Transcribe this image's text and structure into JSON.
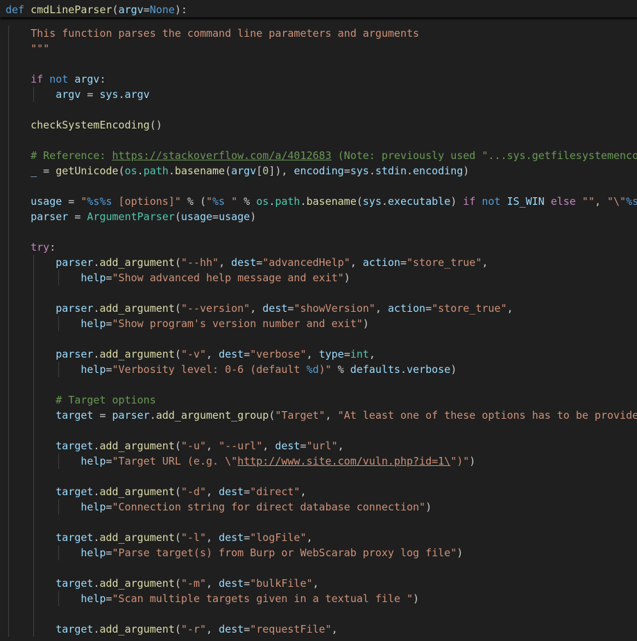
{
  "theme": {
    "background": "#1f1f1f",
    "default": "#cccccc",
    "keyword": "#569cd6",
    "control": "#c586c0",
    "function": "#dcdcaa",
    "variable": "#9cdcfe",
    "string": "#ce9178",
    "comment": "#6a9955",
    "class": "#4ec9b0",
    "number": "#b5cea8",
    "indent_guide": "#404040"
  },
  "sticky_scroll": {
    "line": [
      [
        "k",
        "def"
      ],
      [
        "d",
        " "
      ],
      [
        "f",
        "cmdLineParser"
      ],
      [
        "d",
        "("
      ],
      [
        "p",
        "argv"
      ],
      [
        "d",
        "="
      ],
      [
        "k",
        "None"
      ],
      [
        "d",
        "):"
      ]
    ]
  },
  "code_lines": [
    {
      "indent": 1,
      "tokens": [
        [
          "s",
          "This function parses the command line parameters and arguments"
        ]
      ]
    },
    {
      "indent": 1,
      "tokens": [
        [
          "s",
          "\"\"\""
        ]
      ]
    },
    {
      "indent": 1,
      "tokens": []
    },
    {
      "indent": 1,
      "tokens": [
        [
          "kc",
          "if"
        ],
        [
          "d",
          " "
        ],
        [
          "k",
          "not"
        ],
        [
          "d",
          " "
        ],
        [
          "p",
          "argv"
        ],
        [
          "d",
          ":"
        ]
      ]
    },
    {
      "indent": 2,
      "tokens": [
        [
          "p",
          "argv"
        ],
        [
          "d",
          " = "
        ],
        [
          "p",
          "sys"
        ],
        [
          "d",
          "."
        ],
        [
          "p",
          "argv"
        ]
      ]
    },
    {
      "indent": 1,
      "tokens": []
    },
    {
      "indent": 1,
      "tokens": [
        [
          "f",
          "checkSystemEncoding"
        ],
        [
          "d",
          "()"
        ]
      ]
    },
    {
      "indent": 1,
      "tokens": []
    },
    {
      "indent": 1,
      "tokens": [
        [
          "c",
          "# Reference: "
        ],
        [
          "cu",
          "https://stackoverflow.com/a/4012683"
        ],
        [
          "c",
          " (Note: previously used \"...sys.getfilesystemencoding() or"
        ]
      ]
    },
    {
      "indent": 1,
      "tokens": [
        [
          "p",
          "_"
        ],
        [
          "d",
          " = "
        ],
        [
          "f",
          "getUnicode"
        ],
        [
          "d",
          "("
        ],
        [
          "cl",
          "os"
        ],
        [
          "d",
          "."
        ],
        [
          "cl",
          "path"
        ],
        [
          "d",
          "."
        ],
        [
          "f",
          "basename"
        ],
        [
          "d",
          "("
        ],
        [
          "p",
          "argv"
        ],
        [
          "d",
          "["
        ],
        [
          "n",
          "0"
        ],
        [
          "d",
          "]), "
        ],
        [
          "p",
          "encoding"
        ],
        [
          "d",
          "="
        ],
        [
          "p",
          "sys"
        ],
        [
          "d",
          "."
        ],
        [
          "p",
          "stdin"
        ],
        [
          "d",
          "."
        ],
        [
          "p",
          "encoding"
        ],
        [
          "d",
          ")"
        ]
      ]
    },
    {
      "indent": 1,
      "tokens": []
    },
    {
      "indent": 1,
      "tokens": [
        [
          "p",
          "usage"
        ],
        [
          "d",
          " = "
        ],
        [
          "s",
          "\""
        ],
        [
          "k",
          "%s%s"
        ],
        [
          "s",
          " [options]\""
        ],
        [
          "d",
          " % ("
        ],
        [
          "s",
          "\""
        ],
        [
          "k",
          "%s"
        ],
        [
          "s",
          " \""
        ],
        [
          "d",
          " % "
        ],
        [
          "cl",
          "os"
        ],
        [
          "d",
          "."
        ],
        [
          "cl",
          "path"
        ],
        [
          "d",
          "."
        ],
        [
          "f",
          "basename"
        ],
        [
          "d",
          "("
        ],
        [
          "p",
          "sys"
        ],
        [
          "d",
          "."
        ],
        [
          "p",
          "executable"
        ],
        [
          "d",
          ") "
        ],
        [
          "kc",
          "if"
        ],
        [
          "d",
          " "
        ],
        [
          "k",
          "not"
        ],
        [
          "d",
          " "
        ],
        [
          "p",
          "IS_WIN"
        ],
        [
          "d",
          " "
        ],
        [
          "kc",
          "else"
        ],
        [
          "d",
          " "
        ],
        [
          "s",
          "\"\""
        ],
        [
          "d",
          ", "
        ],
        [
          "s",
          "\"\\\""
        ],
        [
          "k",
          "%s"
        ],
        [
          "s",
          "\\\"\""
        ]
      ]
    },
    {
      "indent": 1,
      "tokens": [
        [
          "p",
          "parser"
        ],
        [
          "d",
          " = "
        ],
        [
          "cl",
          "ArgumentParser"
        ],
        [
          "d",
          "("
        ],
        [
          "p",
          "usage"
        ],
        [
          "d",
          "="
        ],
        [
          "p",
          "usage"
        ],
        [
          "d",
          ")"
        ]
      ]
    },
    {
      "indent": 1,
      "tokens": []
    },
    {
      "indent": 1,
      "tokens": [
        [
          "kc",
          "try"
        ],
        [
          "d",
          ":"
        ]
      ]
    },
    {
      "indent": 2,
      "tokens": [
        [
          "p",
          "parser"
        ],
        [
          "d",
          "."
        ],
        [
          "f",
          "add_argument"
        ],
        [
          "d",
          "("
        ],
        [
          "s",
          "\"--hh\""
        ],
        [
          "d",
          ", "
        ],
        [
          "p",
          "dest"
        ],
        [
          "d",
          "="
        ],
        [
          "s",
          "\"advancedHelp\""
        ],
        [
          "d",
          ", "
        ],
        [
          "p",
          "action"
        ],
        [
          "d",
          "="
        ],
        [
          "s",
          "\"store_true\""
        ],
        [
          "d",
          ","
        ]
      ]
    },
    {
      "indent": 3,
      "tokens": [
        [
          "p",
          "help"
        ],
        [
          "d",
          "="
        ],
        [
          "s",
          "\"Show advanced help message and exit\""
        ],
        [
          "d",
          ")"
        ]
      ]
    },
    {
      "indent": 2,
      "tokens": []
    },
    {
      "indent": 2,
      "tokens": [
        [
          "p",
          "parser"
        ],
        [
          "d",
          "."
        ],
        [
          "f",
          "add_argument"
        ],
        [
          "d",
          "("
        ],
        [
          "s",
          "\"--version\""
        ],
        [
          "d",
          ", "
        ],
        [
          "p",
          "dest"
        ],
        [
          "d",
          "="
        ],
        [
          "s",
          "\"showVersion\""
        ],
        [
          "d",
          ", "
        ],
        [
          "p",
          "action"
        ],
        [
          "d",
          "="
        ],
        [
          "s",
          "\"store_true\""
        ],
        [
          "d",
          ","
        ]
      ]
    },
    {
      "indent": 3,
      "tokens": [
        [
          "p",
          "help"
        ],
        [
          "d",
          "="
        ],
        [
          "s",
          "\"Show program's version number and exit\""
        ],
        [
          "d",
          ")"
        ]
      ]
    },
    {
      "indent": 2,
      "tokens": []
    },
    {
      "indent": 2,
      "tokens": [
        [
          "p",
          "parser"
        ],
        [
          "d",
          "."
        ],
        [
          "f",
          "add_argument"
        ],
        [
          "d",
          "("
        ],
        [
          "s",
          "\"-v\""
        ],
        [
          "d",
          ", "
        ],
        [
          "p",
          "dest"
        ],
        [
          "d",
          "="
        ],
        [
          "s",
          "\"verbose\""
        ],
        [
          "d",
          ", "
        ],
        [
          "p",
          "type"
        ],
        [
          "d",
          "="
        ],
        [
          "cl",
          "int"
        ],
        [
          "d",
          ","
        ]
      ]
    },
    {
      "indent": 3,
      "tokens": [
        [
          "p",
          "help"
        ],
        [
          "d",
          "="
        ],
        [
          "s",
          "\"Verbosity level: 0-6 (default "
        ],
        [
          "k",
          "%d"
        ],
        [
          "s",
          ")\""
        ],
        [
          "d",
          " % "
        ],
        [
          "p",
          "defaults"
        ],
        [
          "d",
          "."
        ],
        [
          "p",
          "verbose"
        ],
        [
          "d",
          ")"
        ]
      ]
    },
    {
      "indent": 2,
      "tokens": []
    },
    {
      "indent": 2,
      "tokens": [
        [
          "c",
          "# Target options"
        ]
      ]
    },
    {
      "indent": 2,
      "tokens": [
        [
          "p",
          "target"
        ],
        [
          "d",
          " = "
        ],
        [
          "p",
          "parser"
        ],
        [
          "d",
          "."
        ],
        [
          "f",
          "add_argument_group"
        ],
        [
          "d",
          "("
        ],
        [
          "s",
          "\"Target\""
        ],
        [
          "d",
          ", "
        ],
        [
          "s",
          "\"At least one of these options has to be provided to"
        ]
      ]
    },
    {
      "indent": 2,
      "tokens": []
    },
    {
      "indent": 2,
      "tokens": [
        [
          "p",
          "target"
        ],
        [
          "d",
          "."
        ],
        [
          "f",
          "add_argument"
        ],
        [
          "d",
          "("
        ],
        [
          "s",
          "\"-u\""
        ],
        [
          "d",
          ", "
        ],
        [
          "s",
          "\"--url\""
        ],
        [
          "d",
          ", "
        ],
        [
          "p",
          "dest"
        ],
        [
          "d",
          "="
        ],
        [
          "s",
          "\"url\""
        ],
        [
          "d",
          ","
        ]
      ]
    },
    {
      "indent": 3,
      "tokens": [
        [
          "p",
          "help"
        ],
        [
          "d",
          "="
        ],
        [
          "s",
          "\"Target URL (e.g. \\\""
        ],
        [
          "su",
          "http://www.site.com/vuln.php?id=1\\"
        ],
        [
          "s",
          "\")\""
        ],
        [
          "d",
          ")"
        ]
      ]
    },
    {
      "indent": 2,
      "tokens": []
    },
    {
      "indent": 2,
      "tokens": [
        [
          "p",
          "target"
        ],
        [
          "d",
          "."
        ],
        [
          "f",
          "add_argument"
        ],
        [
          "d",
          "("
        ],
        [
          "s",
          "\"-d\""
        ],
        [
          "d",
          ", "
        ],
        [
          "p",
          "dest"
        ],
        [
          "d",
          "="
        ],
        [
          "s",
          "\"direct\""
        ],
        [
          "d",
          ","
        ]
      ]
    },
    {
      "indent": 3,
      "tokens": [
        [
          "p",
          "help"
        ],
        [
          "d",
          "="
        ],
        [
          "s",
          "\"Connection string for direct database connection\""
        ],
        [
          "d",
          ")"
        ]
      ]
    },
    {
      "indent": 2,
      "tokens": []
    },
    {
      "indent": 2,
      "tokens": [
        [
          "p",
          "target"
        ],
        [
          "d",
          "."
        ],
        [
          "f",
          "add_argument"
        ],
        [
          "d",
          "("
        ],
        [
          "s",
          "\"-l\""
        ],
        [
          "d",
          ", "
        ],
        [
          "p",
          "dest"
        ],
        [
          "d",
          "="
        ],
        [
          "s",
          "\"logFile\""
        ],
        [
          "d",
          ","
        ]
      ]
    },
    {
      "indent": 3,
      "tokens": [
        [
          "p",
          "help"
        ],
        [
          "d",
          "="
        ],
        [
          "s",
          "\"Parse target(s) from Burp or WebScarab proxy log file\""
        ],
        [
          "d",
          ")"
        ]
      ]
    },
    {
      "indent": 2,
      "tokens": []
    },
    {
      "indent": 2,
      "tokens": [
        [
          "p",
          "target"
        ],
        [
          "d",
          "."
        ],
        [
          "f",
          "add_argument"
        ],
        [
          "d",
          "("
        ],
        [
          "s",
          "\"-m\""
        ],
        [
          "d",
          ", "
        ],
        [
          "p",
          "dest"
        ],
        [
          "d",
          "="
        ],
        [
          "s",
          "\"bulkFile\""
        ],
        [
          "d",
          ","
        ]
      ]
    },
    {
      "indent": 3,
      "tokens": [
        [
          "p",
          "help"
        ],
        [
          "d",
          "="
        ],
        [
          "s",
          "\"Scan multiple targets given in a textual file \""
        ],
        [
          "d",
          ")"
        ]
      ]
    },
    {
      "indent": 2,
      "tokens": []
    },
    {
      "indent": 2,
      "tokens": [
        [
          "p",
          "target"
        ],
        [
          "d",
          "."
        ],
        [
          "f",
          "add_argument"
        ],
        [
          "d",
          "("
        ],
        [
          "s",
          "\"-r\""
        ],
        [
          "d",
          ", "
        ],
        [
          "p",
          "dest"
        ],
        [
          "d",
          "="
        ],
        [
          "s",
          "\"requestFile\""
        ],
        [
          "d",
          ","
        ]
      ]
    }
  ]
}
